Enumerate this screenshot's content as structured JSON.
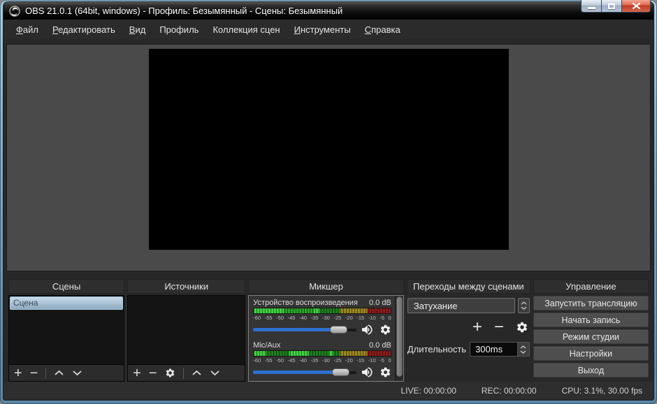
{
  "window": {
    "title": "OBS 21.0.1 (64bit, windows) - Профиль: Безымянный - Сцены: Безымянный"
  },
  "menu": {
    "items": [
      {
        "label": "Файл",
        "u": "true"
      },
      {
        "label": "Редактировать",
        "u": "true"
      },
      {
        "label": "Вид",
        "u": "true"
      },
      {
        "label": "Профиль",
        "u": "false"
      },
      {
        "label": "Коллекция сцен",
        "u": "false"
      },
      {
        "label": "Инструменты",
        "u": "true"
      },
      {
        "label": "Справка",
        "u": "true"
      }
    ]
  },
  "icons": {
    "add": "+",
    "remove": "−"
  },
  "panels": {
    "scenes": {
      "title": "Сцены",
      "items": [
        "Сцена"
      ]
    },
    "sources": {
      "title": "Источники",
      "items": []
    },
    "mixer": {
      "title": "Микшер",
      "channels": [
        {
          "name": "Устройство воспроизведения",
          "db": "0.0 dB",
          "volume_pct": 83
        },
        {
          "name": "Mic/Aux",
          "db": "0.0 dB",
          "volume_pct": 85
        }
      ],
      "scale": [
        "-60",
        "-55",
        "-50",
        "-45",
        "-40",
        "-35",
        "-30",
        "-25",
        "-20",
        "-15",
        "-10",
        "-5",
        "0"
      ]
    },
    "transitions": {
      "title": "Переходы между сценами",
      "selected": "Затухание",
      "duration_label": "Длительность",
      "duration_value": "300ms"
    },
    "controls": {
      "title": "Управление",
      "buttons": [
        "Запустить трансляцию",
        "Начать запись",
        "Режим студии",
        "Настройки",
        "Выход"
      ]
    }
  },
  "statusbar": {
    "live": "LIVE: 00:00:00",
    "rec": "REC: 00:00:00",
    "cpu": "CPU: 3.1%, 30.00 fps"
  },
  "colors": {
    "frame_border": "#84aec9",
    "window_bg": "#282828",
    "preview_bg": "#4a4a4a",
    "selection": "#a9cbe4",
    "slider_fill": "#2e6fd0",
    "meter_green": "#3fd43f",
    "meter_yellow": "#99891e",
    "meter_red": "#8e1c1c",
    "close_button": "#c03a24"
  }
}
